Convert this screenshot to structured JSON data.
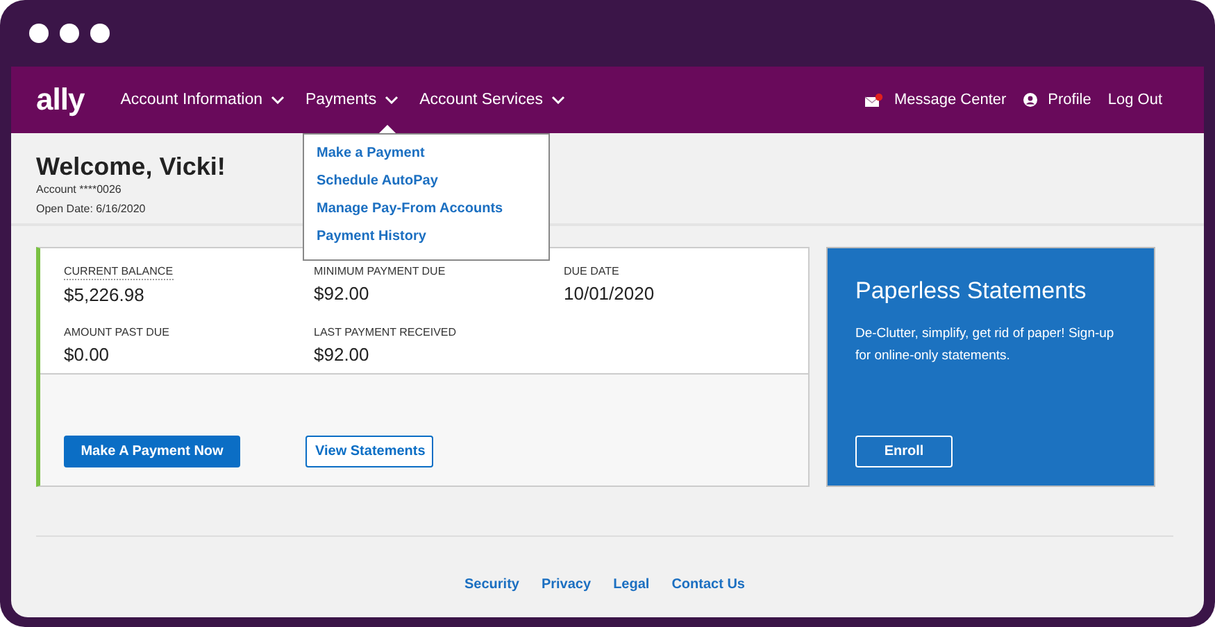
{
  "nav": {
    "logo": "ally",
    "menus": [
      {
        "label": "Account Information",
        "expanded": false
      },
      {
        "label": "Payments",
        "expanded": true,
        "items": [
          "Make a Payment",
          "Schedule AutoPay",
          "Manage Pay-From Accounts",
          "Payment History"
        ]
      },
      {
        "label": "Account Services",
        "expanded": false
      }
    ],
    "message_center": {
      "label": "Message Center",
      "unread": true
    },
    "profile": "Profile",
    "logout": "Log Out"
  },
  "welcome": {
    "title": "Welcome, Vicki!",
    "account": "Account ****0026",
    "open_date": "Open Date: 6/16/2020"
  },
  "summary": {
    "fields": [
      {
        "label": "CURRENT BALANCE",
        "value": "$5,226.98"
      },
      {
        "label": "MINIMUM PAYMENT DUE",
        "value": "$92.00"
      },
      {
        "label": "DUE DATE",
        "value": "10/01/2020"
      },
      {
        "label": "AMOUNT PAST DUE",
        "value": "$0.00"
      },
      {
        "label": "LAST PAYMENT RECEIVED",
        "value": "$92.00"
      }
    ],
    "buttons": [
      {
        "label": "Make A Payment Now",
        "kind": "primary"
      },
      {
        "label": "View Statements",
        "kind": "secondary"
      }
    ]
  },
  "promo": {
    "title": "Paperless Statements",
    "text": "De-Clutter, simplify, get rid of paper! Sign-up for online-only statements.",
    "button": "Enroll"
  },
  "footer": {
    "links": [
      "Security",
      "Privacy",
      "Legal",
      "Contact Us"
    ]
  }
}
